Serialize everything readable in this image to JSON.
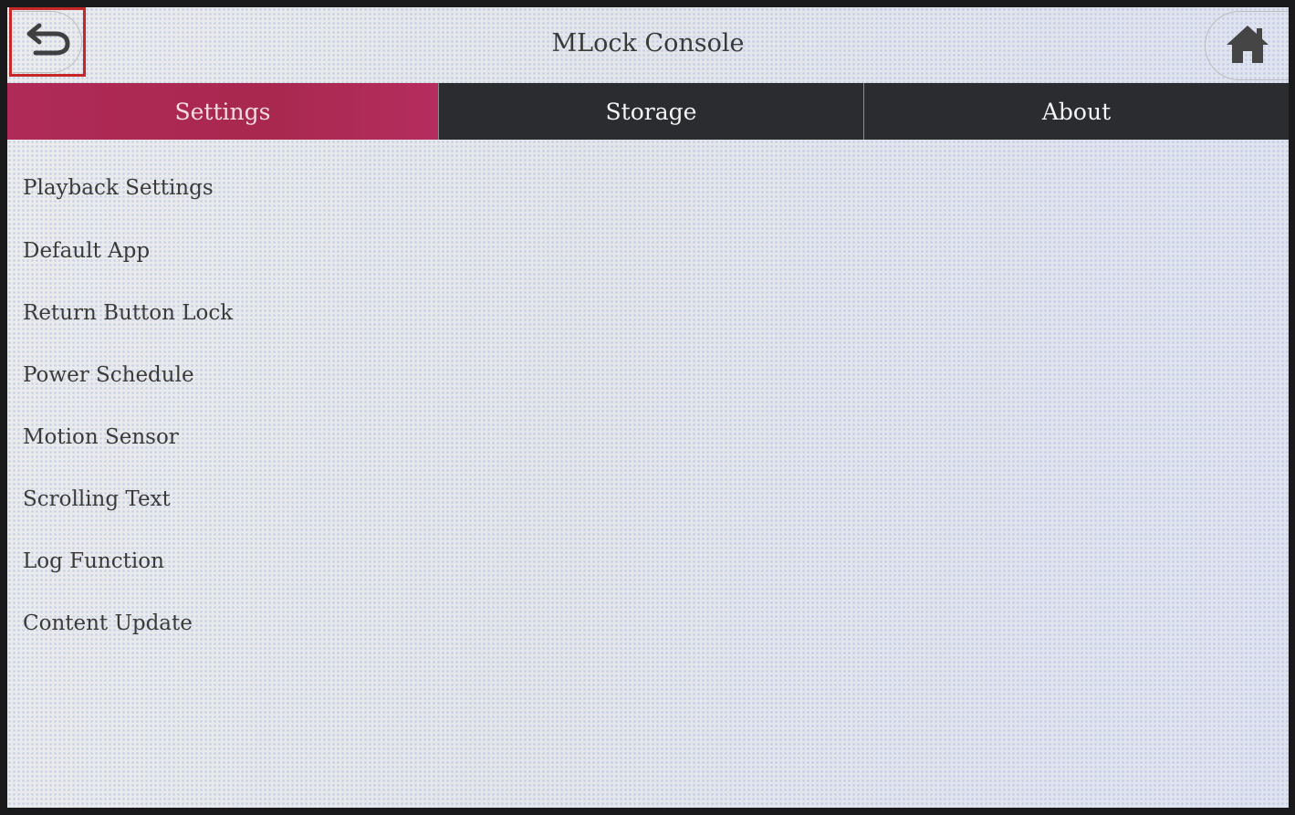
{
  "header": {
    "title": "MLock Console",
    "back_icon": "back-arrow-icon",
    "home_icon": "home-icon"
  },
  "tabs": [
    {
      "label": "Settings",
      "active": true
    },
    {
      "label": "Storage",
      "active": false
    },
    {
      "label": "About",
      "active": false
    }
  ],
  "menu": {
    "items": [
      {
        "label": "Playback Settings"
      },
      {
        "label": "Default App"
      },
      {
        "label": "Return Button Lock"
      },
      {
        "label": "Power Schedule"
      },
      {
        "label": "Motion Sensor"
      },
      {
        "label": "Scrolling Text"
      },
      {
        "label": "Log Function"
      },
      {
        "label": "Content Update"
      }
    ]
  },
  "colors": {
    "active_tab": "#b02a58",
    "inactive_tab": "#2b2c2f",
    "highlight_border": "#c62828"
  }
}
